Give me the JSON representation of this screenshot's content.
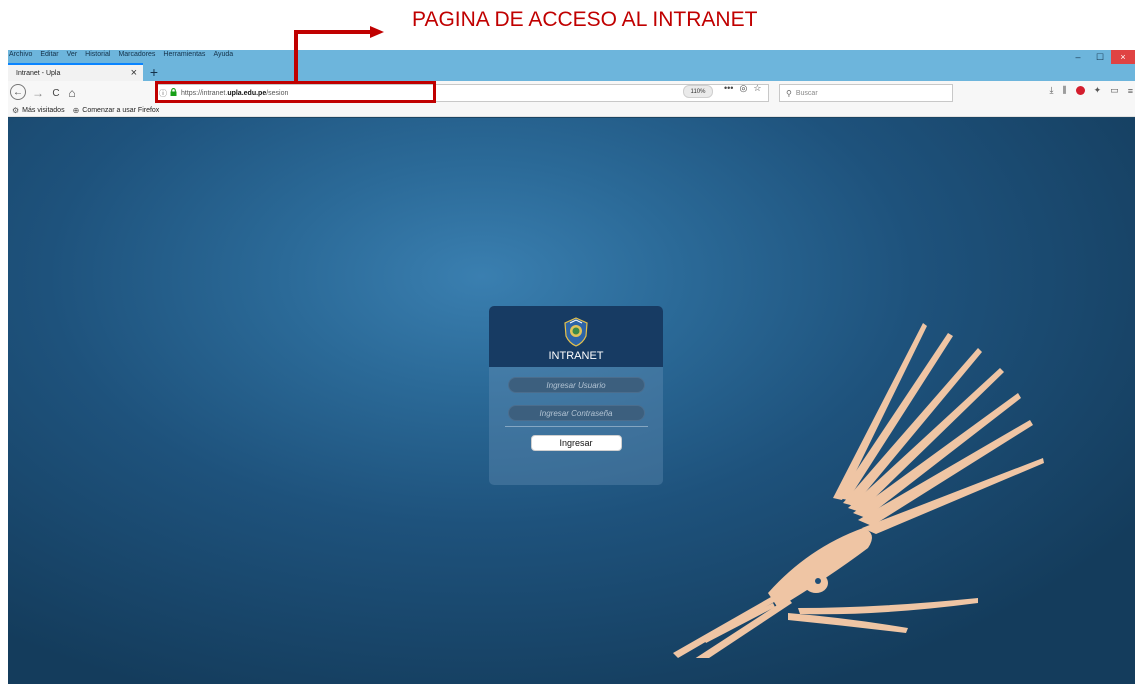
{
  "annotation": {
    "label": "PAGINA DE ACCESO AL INTRANET",
    "color": "#c00000"
  },
  "menu": [
    "Archivo",
    "Editar",
    "Ver",
    "Historial",
    "Marcadores",
    "Herramientas",
    "Ayuda"
  ],
  "window_controls": {
    "minimize": "–",
    "maximize": "☐",
    "close": "×"
  },
  "tab": {
    "title": "Intranet - Upla",
    "close": "×",
    "new_tab": "+"
  },
  "nav": {
    "back": "←",
    "forward": "→",
    "reload": "C",
    "home": "⌂",
    "url_prefix": "https://intranet.",
    "url_domain": "upla.edu.pe",
    "url_path": "/sesion",
    "zoom": "110%",
    "page_actions": "•••",
    "pocket": "◎",
    "bookmark_star": "☆",
    "search_placeholder": "Buscar"
  },
  "toolbar_icons": [
    "download-icon",
    "library-icon",
    "adblock-icon",
    "extension-icon",
    "sidebar-icon",
    "menu-icon"
  ],
  "bookmarks": [
    {
      "icon": "gear-icon",
      "label": "Más visitados"
    },
    {
      "icon": "globe-icon",
      "label": "Comenzar a usar Firefox"
    }
  ],
  "login": {
    "title": "INTRANET",
    "username_placeholder": "Ingresar Usuario",
    "password_placeholder": "Ingresar Contraseña",
    "submit_label": "Ingresar"
  },
  "colors": {
    "titlebar": "#6db5dc",
    "page_bg": "#2b6a98",
    "login_header": "#173b63",
    "condor": "#efc5a4"
  }
}
